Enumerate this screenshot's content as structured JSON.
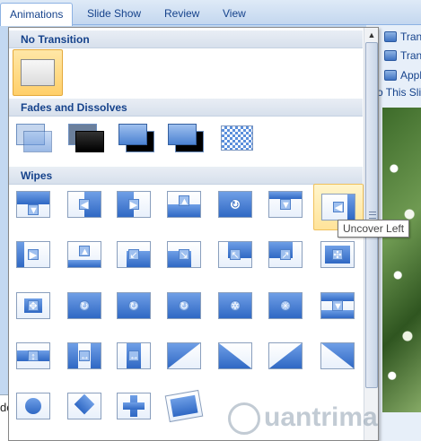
{
  "ribbon": {
    "tabs": [
      {
        "label": "Animations",
        "active": true
      },
      {
        "label": "Slide Show",
        "active": false
      },
      {
        "label": "Review",
        "active": false
      },
      {
        "label": "View",
        "active": false
      }
    ]
  },
  "right_panel": {
    "commands": [
      "Tran",
      "Tran",
      "Appl"
    ],
    "apply_link": "o This Sli"
  },
  "gallery": {
    "sections": [
      {
        "title": "No Transition"
      },
      {
        "title": "Fades and Dissolves"
      },
      {
        "title": "Wipes"
      }
    ],
    "tooltip": "Uncover Left",
    "selected_item": "No Transition",
    "hovered_item": "Uncover Left"
  },
  "bottom_left_text": "do",
  "watermark": "uantrimang",
  "colors": {
    "accent": "#15428b",
    "selected": "#ffcf6a",
    "tile_fill": "#2f68c4"
  }
}
